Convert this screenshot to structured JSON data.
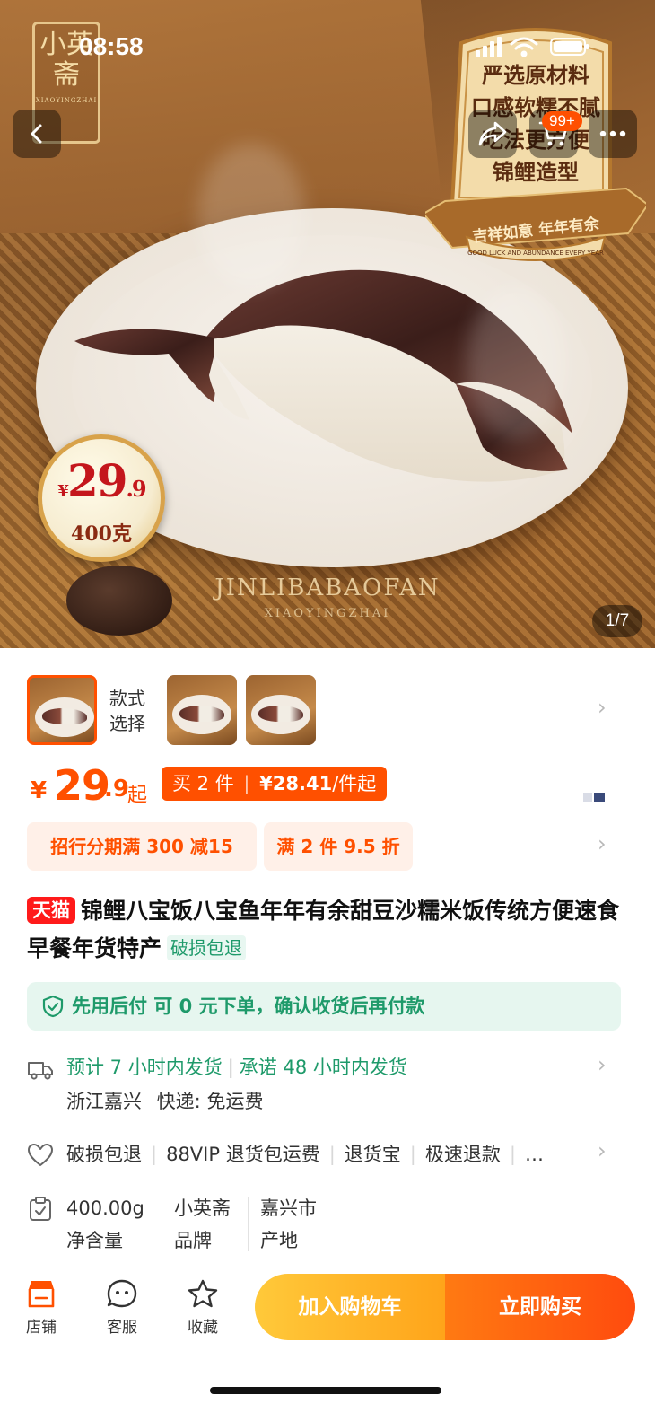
{
  "status_bar": {
    "time": "08:58"
  },
  "hero": {
    "logo_glyph": "小英斋",
    "logo_sub": "XIAOYINGZHAI",
    "badge_card": {
      "lines": [
        "严选原材料",
        "口感软糯不腻",
        "吃法更方便",
        "锦鲤造型"
      ],
      "ribbon": "吉祥如意 年年有余",
      "ribbon_sub": "GOOD LUCK AND ABUNDANCE EVERY YEAR"
    },
    "price_seal": {
      "yen": "¥",
      "int": "29",
      "dec": ".9",
      "weight": "400克"
    },
    "watermark": "JINLIBABAOFAN",
    "watermark_sub": "XIAOYINGZHAI",
    "cart_count": "99+",
    "page_indicator": "1/7"
  },
  "variants": {
    "label_line1": "款式",
    "label_line2": "选择"
  },
  "price": {
    "currency": "¥",
    "integer": "29",
    "decimal": ".9",
    "suffix": "起",
    "promo_part1": "买 2 件",
    "promo_sep": "|",
    "promo_price": "¥28.41",
    "promo_unit": "/件起"
  },
  "coupons": [
    "招行分期满 300 减15",
    "满 2 件 9.5 折"
  ],
  "title": {
    "tmall_badge": "天猫",
    "text": "锦鲤八宝饭八宝鱼年年有余甜豆沙糯米饭传统方便速食早餐年货特产",
    "tag": "破损包退"
  },
  "bnpl": {
    "text": "先用后付 可 0 元下单，确认收货后再付款"
  },
  "shipping": {
    "estimate": "预计 7 小时内发货",
    "promise": "承诺 48 小时内发货",
    "origin": "浙江嘉兴",
    "express_label": "快递:",
    "express_value": "免运费"
  },
  "services": [
    "破损包退",
    "88VIP 退货包运费",
    "退货宝",
    "极速退款",
    "…"
  ],
  "specs": [
    {
      "value": "400.00g",
      "label": "净含量"
    },
    {
      "value": "小英斋",
      "label": "品牌"
    },
    {
      "value": "嘉兴市",
      "label": "产地"
    }
  ],
  "bottom_bar": {
    "store": "店铺",
    "service": "客服",
    "favorite": "收藏",
    "add_to_cart": "加入购物车",
    "buy_now": "立即购买"
  },
  "colors": {
    "accent": "#ff5000",
    "green": "#1e9a6a",
    "cart_btn": "#ffb020",
    "buy_btn": "#ff5a10"
  }
}
